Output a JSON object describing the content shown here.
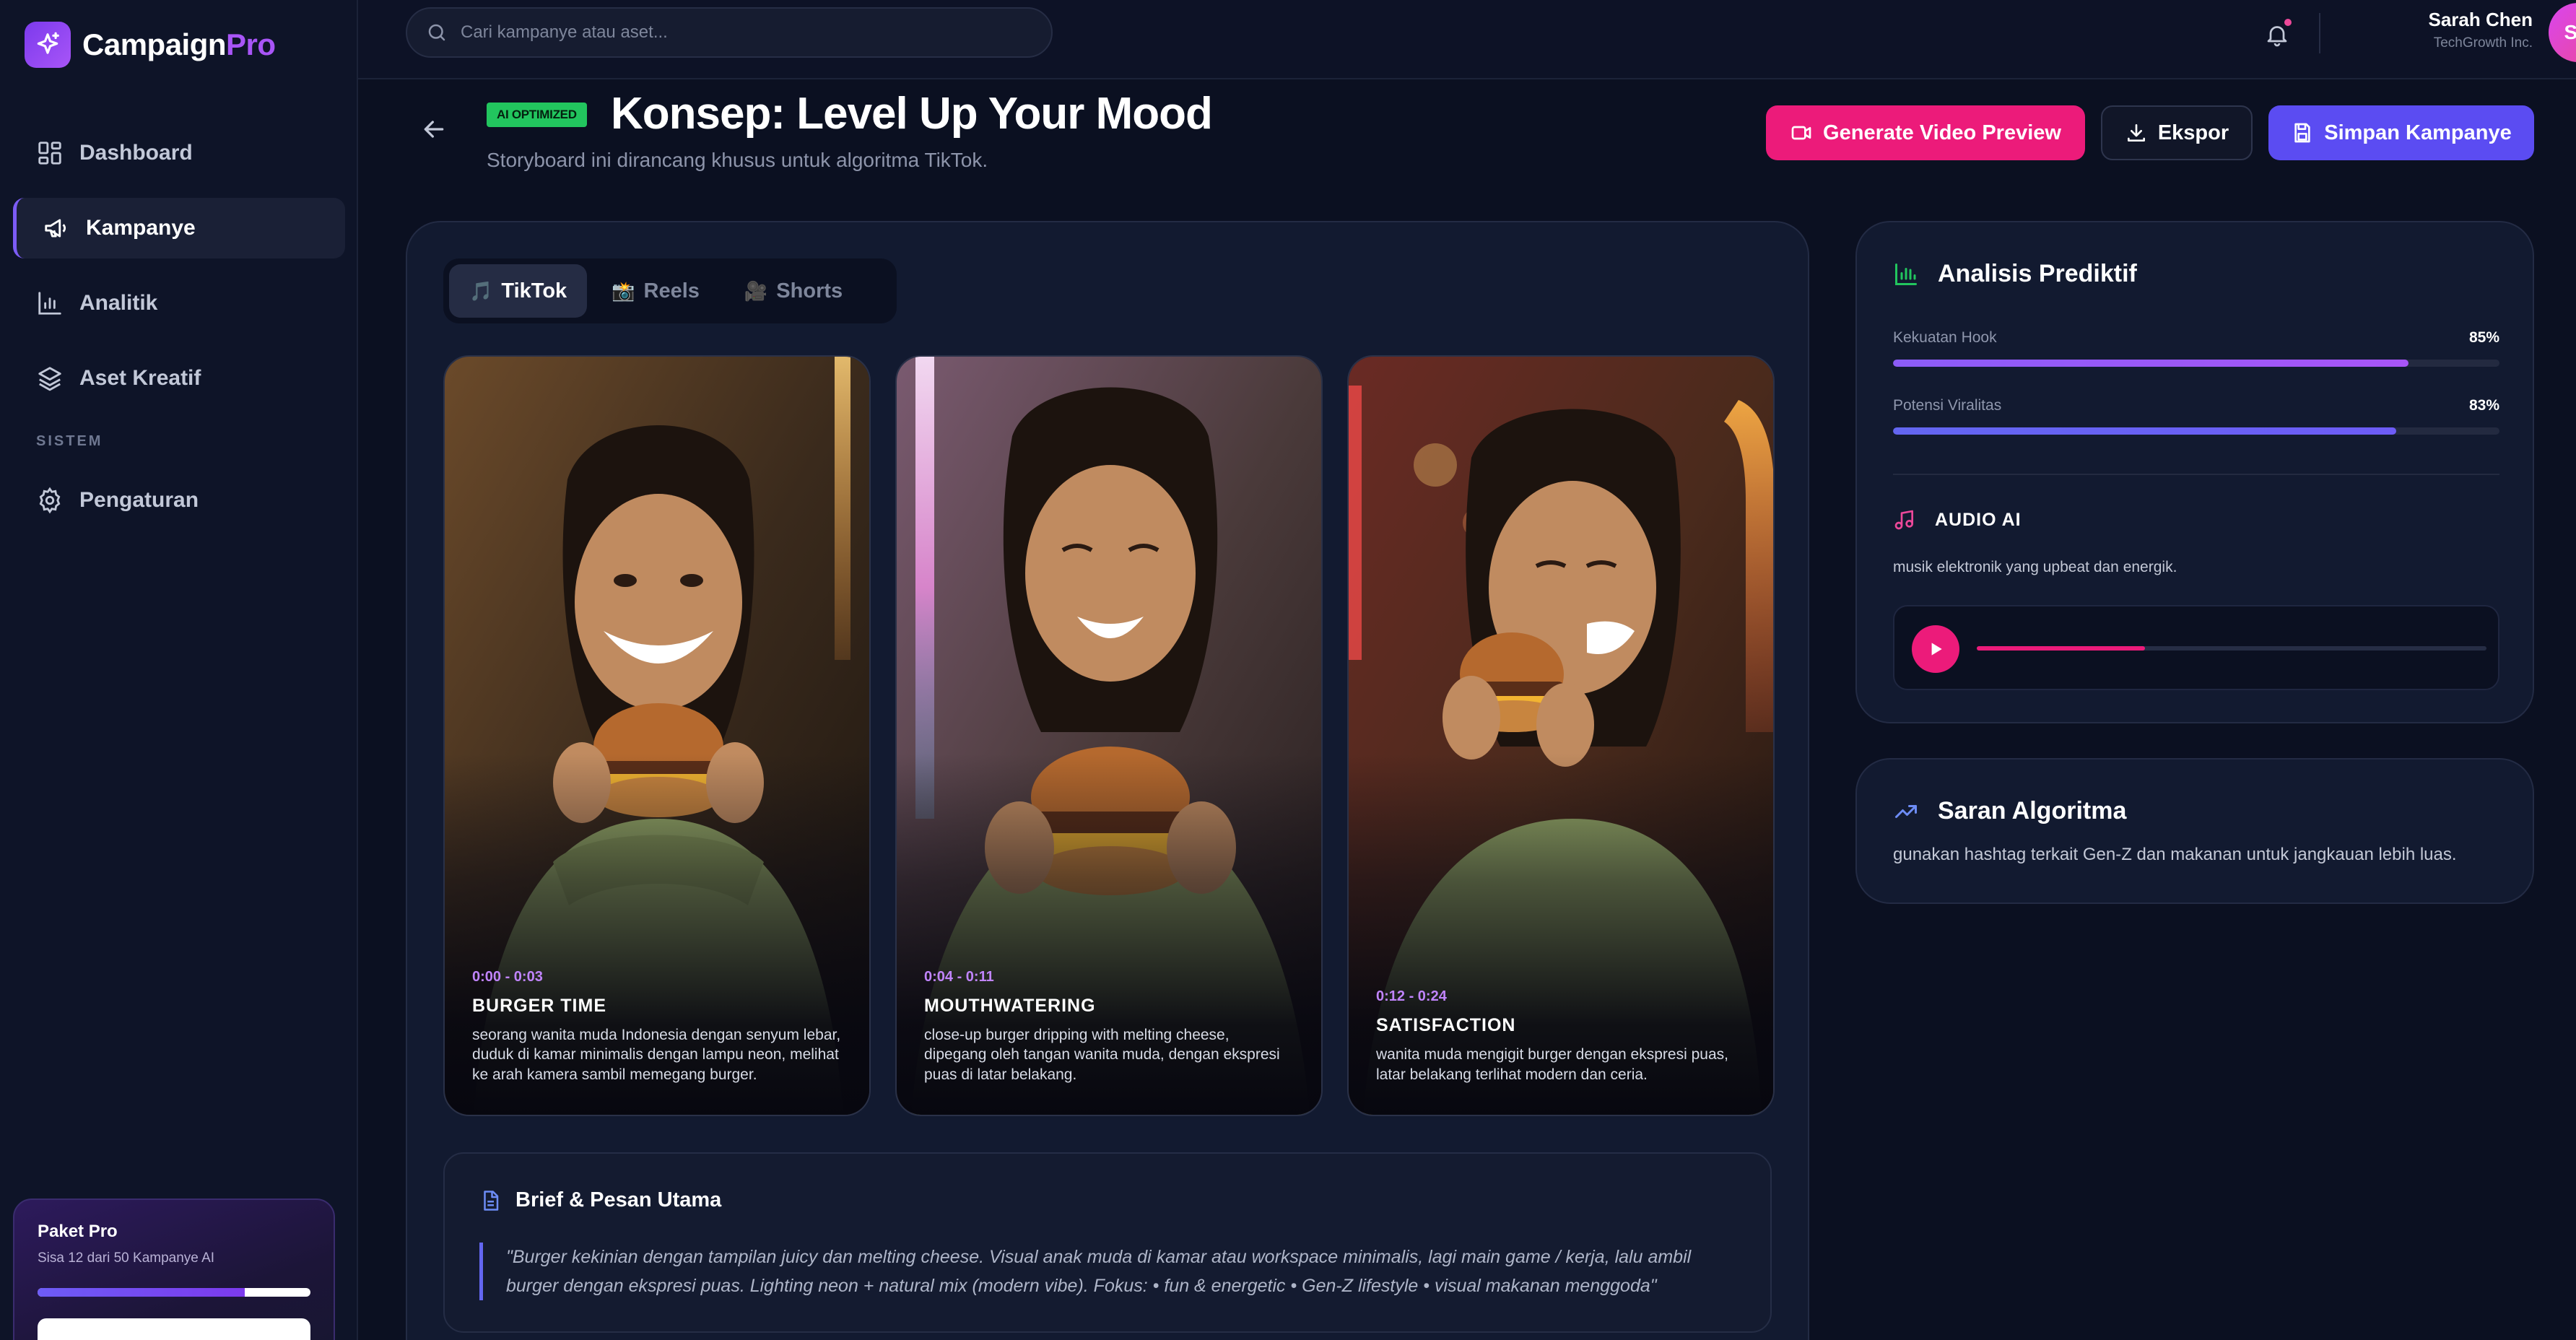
{
  "brand": {
    "name": "Campaign",
    "name_accent": "Pro"
  },
  "sidebar": {
    "items": [
      {
        "label": "Dashboard"
      },
      {
        "label": "Kampanye"
      },
      {
        "label": "Analitik"
      },
      {
        "label": "Aset Kreatif"
      }
    ],
    "section_label": "SISTEM",
    "settings_label": "Pengaturan",
    "plan": {
      "title": "Paket Pro",
      "subtitle": "Sisa 12 dari 50 Kampanye AI",
      "usage_fraction": 0.76
    }
  },
  "topbar": {
    "search_placeholder": "Cari kampanye atau aset...",
    "user": {
      "name": "Sarah Chen",
      "org": "TechGrowth Inc.",
      "initials": "SC"
    }
  },
  "header": {
    "badge": "AI OPTIMIZED",
    "title": "Konsep: Level Up Your Mood",
    "subtitle": "Storyboard ini dirancang khusus untuk algoritma TikTok.",
    "buttons": {
      "video": "Generate Video Preview",
      "export": "Ekspor",
      "save": "Simpan Kampanye"
    }
  },
  "storyboard": {
    "tabs": [
      {
        "icon": "🎵",
        "label": "TikTok"
      },
      {
        "icon": "📸",
        "label": "Reels"
      },
      {
        "icon": "🎥",
        "label": "Shorts"
      }
    ],
    "scenes": [
      {
        "time": "0:00 - 0:03",
        "title": "BURGER TIME",
        "desc": "seorang wanita muda Indonesia dengan senyum lebar, duduk di kamar minimalis dengan lampu neon, melihat ke arah kamera sambil memegang burger."
      },
      {
        "time": "0:04 - 0:11",
        "title": "MOUTHWATERING",
        "desc": "close-up burger dripping with melting cheese, dipegang oleh tangan wanita muda, dengan ekspresi puas di latar belakang."
      },
      {
        "time": "0:12 - 0:24",
        "title": "SATISFACTION",
        "desc": "wanita muda mengigit burger dengan ekspresi puas, latar belakang terlihat modern dan ceria."
      }
    ],
    "brief": {
      "title": "Brief & Pesan Utama",
      "quote": "\"Burger kekinian dengan tampilan juicy dan melting cheese. Visual anak muda di kamar atau workspace minimalis, lagi main game / kerja, lalu ambil burger dengan ekspresi puas. Lighting neon + natural mix (modern vibe). Fokus: • fun & energetic • Gen-Z lifestyle • visual makanan menggoda\""
    }
  },
  "predictive": {
    "title": "Analisis Prediktif",
    "metrics": [
      {
        "label": "Kekuatan Hook",
        "value": "85%",
        "fraction": 0.85
      },
      {
        "label": "Potensi Viralitas",
        "value": "83%",
        "fraction": 0.83
      }
    ],
    "audio": {
      "title": "AUDIO AI",
      "desc": "musik elektronik yang upbeat dan energik.",
      "progress": 0.33
    }
  },
  "algo": {
    "title": "Saran Algoritma",
    "text": "gunakan hashtag terkait Gen-Z dan makanan untuk jangkauan lebih luas."
  },
  "colors": {
    "accent_purple": "#a855f7",
    "accent_pink": "#ec1b7a",
    "accent_indigo": "#5b4cf2",
    "badge_green": "#22c55e"
  }
}
